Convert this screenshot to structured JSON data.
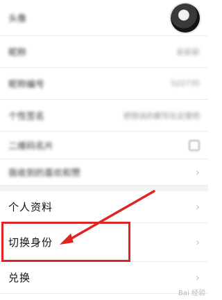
{
  "profile": {
    "rows": [
      {
        "label": "头像",
        "value": "",
        "type": "avatar"
      },
      {
        "label": "昵称",
        "value": "彩彩彩",
        "type": "text"
      },
      {
        "label": "昵称编号",
        "value": "522735",
        "type": "text"
      },
      {
        "label": "个性签名",
        "value": "把想说的都写在这里吧",
        "type": "text"
      },
      {
        "label": "二维码名片",
        "value": "",
        "type": "icon"
      },
      {
        "label": "我收到的喜欢和赞",
        "value": "",
        "type": "text"
      }
    ],
    "menu": [
      {
        "label": "个人资料"
      },
      {
        "label": "切换身份"
      },
      {
        "label": "兑换"
      }
    ]
  },
  "icons": {
    "avatar": "avatar-image",
    "qr": "qr-code-icon",
    "chevron": "chevron-right-icon",
    "arrow": "red-arrow"
  },
  "colors": {
    "highlight": "#e02424"
  },
  "watermark": "Bai 经验"
}
